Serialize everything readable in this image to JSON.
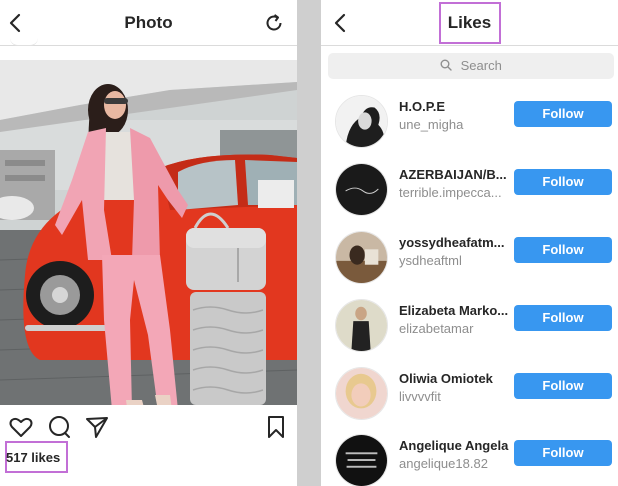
{
  "left": {
    "title": "Photo",
    "likes": "517 likes",
    "icons": [
      "back-chevron-icon",
      "refresh-icon",
      "heart-icon",
      "comment-icon",
      "share-icon",
      "bookmark-icon"
    ]
  },
  "right": {
    "title": "Likes",
    "search_placeholder": "Search",
    "follow_label": "Follow",
    "users": [
      {
        "name": "H.O.P.E",
        "handle": "une_migha"
      },
      {
        "name": "AZERBAIJAN/B...",
        "handle": "terrible.impecca..."
      },
      {
        "name": "yossydheafatm...",
        "handle": "ysdheaftml"
      },
      {
        "name": "Elizabeta Marko...",
        "handle": "elizabetamar"
      },
      {
        "name": "Oliwia Omiotek",
        "handle": "livvvvfit"
      },
      {
        "name": "Angelique Angela",
        "handle": "angelique18.82"
      }
    ]
  },
  "colors": {
    "follow_blue": "#3897f0",
    "highlight": "#c26fd6"
  }
}
